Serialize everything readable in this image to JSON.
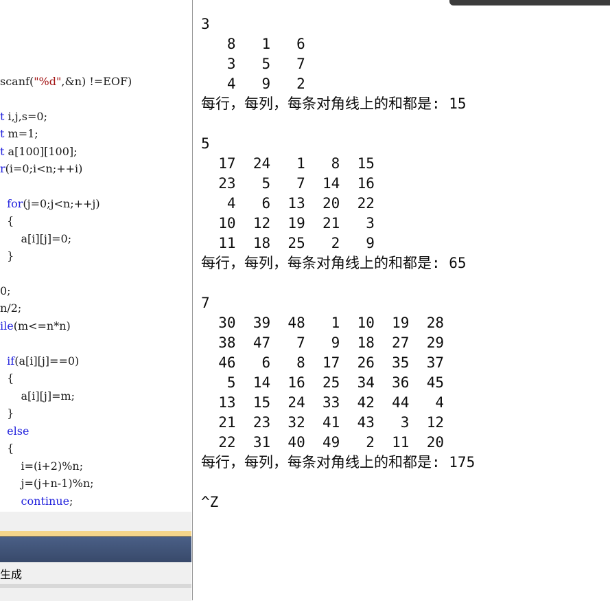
{
  "editor": {
    "code_lines": [
      [
        "",
        [
          [
            "",
            "scanf(",
            ""
          ],
          [
            "str",
            "\"%d\"",
            ""
          ],
          [
            "",
            ",&n) !=EOF)",
            ""
          ]
        ]
      ],
      [
        "",
        [
          [
            "kw",
            "t",
            ""
          ],
          [
            "",
            " i,j,s=0;",
            ""
          ]
        ]
      ],
      [
        "",
        [
          [
            "kw",
            "t",
            ""
          ],
          [
            "",
            " m=1;",
            ""
          ]
        ]
      ],
      [
        "",
        [
          [
            "kw",
            "t",
            ""
          ],
          [
            "",
            " a[100][100];",
            ""
          ]
        ]
      ],
      [
        "",
        [
          [
            "kw",
            "r",
            ""
          ],
          [
            "",
            "(i=0;i<n;++i)",
            ""
          ]
        ]
      ],
      [
        "",
        [
          [
            "",
            "",
            ""
          ]
        ]
      ],
      [
        "",
        [
          [
            "kw",
            "  for",
            ""
          ],
          [
            "",
            "(j=0;j<n;++j)",
            ""
          ]
        ]
      ],
      [
        "",
        [
          [
            "",
            "  {",
            ""
          ]
        ]
      ],
      [
        "",
        [
          [
            "",
            "      a[i][j]=0;",
            ""
          ]
        ]
      ],
      [
        "",
        [
          [
            "",
            "  }",
            ""
          ]
        ]
      ],
      [
        "",
        [
          [
            "",
            "",
            ""
          ]
        ]
      ],
      [
        "",
        [
          [
            "",
            "0;",
            ""
          ]
        ]
      ],
      [
        "",
        [
          [
            "",
            "n/2;",
            ""
          ]
        ]
      ],
      [
        "",
        [
          [
            "kw",
            "ile",
            ""
          ],
          [
            "",
            "(m<=n*n)",
            ""
          ]
        ]
      ],
      [
        "",
        [
          [
            "",
            "",
            ""
          ]
        ]
      ],
      [
        "",
        [
          [
            "kw",
            "  if",
            ""
          ],
          [
            "",
            "(a[i][j]==0)",
            ""
          ]
        ]
      ],
      [
        "",
        [
          [
            "",
            "  {",
            ""
          ]
        ]
      ],
      [
        "",
        [
          [
            "",
            "      a[i][j]=m;",
            ""
          ]
        ]
      ],
      [
        "",
        [
          [
            "",
            "  }",
            ""
          ]
        ]
      ],
      [
        "",
        [
          [
            "kw",
            "  else",
            ""
          ]
        ]
      ],
      [
        "",
        [
          [
            "",
            "  {",
            ""
          ]
        ]
      ],
      [
        "",
        [
          [
            "",
            "      i=(i+2)%n;",
            ""
          ]
        ]
      ],
      [
        "",
        [
          [
            "",
            "      j=(j+n-1)%n;",
            ""
          ]
        ]
      ],
      [
        "",
        [
          [
            "kw",
            "      continue",
            ""
          ],
          [
            "",
            ";",
            ""
          ]
        ]
      ]
    ]
  },
  "output_panel": {
    "label": "生成"
  },
  "console": {
    "lines": [
      "3",
      "   8   1   6",
      "   3   5   7",
      "   4   9   2",
      "每行，每列，每条对角线上的和都是: 15",
      "",
      "5",
      "  17  24   1   8  15",
      "  23   5   7  14  16",
      "   4   6  13  20  22",
      "  10  12  19  21   3",
      "  11  18  25   2   9",
      "每行，每列，每条对角线上的和都是: 65",
      "",
      "7",
      "  30  39  48   1  10  19  28",
      "  38  47   7   9  18  27  29",
      "  46   6   8  17  26  35  37",
      "   5  14  16  25  34  36  45",
      "  13  15  24  33  42  44   4",
      "  21  23  32  41  43   3  12",
      "  22  31  40  49   2  11  20",
      "每行，每列，每条对角线上的和都是: 175",
      "",
      "^Z"
    ]
  },
  "colors": {
    "keyword": "#2222dd",
    "string": "#a31515",
    "console_text": "#0c0c0c"
  }
}
